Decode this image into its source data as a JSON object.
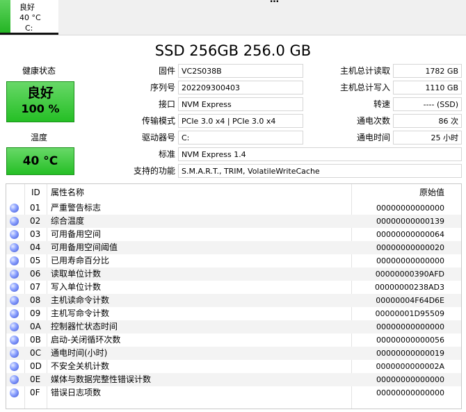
{
  "drive_tab": {
    "status": "良好",
    "temperature": "40 °C",
    "drive_letter": "C:"
  },
  "tab_overflow_glyph": "…",
  "title": "SSD 256GB 256.0 GB",
  "health": {
    "label": "健康状态",
    "status": "良好",
    "percent": "100 %"
  },
  "temperature": {
    "label": "温度",
    "value": "40 °C"
  },
  "info_left": [
    {
      "label": "固件",
      "value": "VC2S038B"
    },
    {
      "label": "序列号",
      "value": "202209300403"
    },
    {
      "label": "接口",
      "value": "NVM Express"
    },
    {
      "label": "传输模式",
      "value": "PCIe 3.0 x4 | PCIe 3.0 x4"
    },
    {
      "label": "驱动器号",
      "value": "C:"
    }
  ],
  "info_right": [
    {
      "label": "主机总计读取",
      "value": "1782 GB"
    },
    {
      "label": "主机总计写入",
      "value": "1110 GB"
    },
    {
      "label": "转速",
      "value": "---- (SSD)"
    },
    {
      "label": "通电次数",
      "value": "86 次"
    },
    {
      "label": "通电时间",
      "value": "25 小时"
    }
  ],
  "standard": {
    "label": "标准",
    "value": "NVM Express 1.4"
  },
  "features": {
    "label": "支持的功能",
    "value": "S.M.A.R.T., TRIM, VolatileWriteCache"
  },
  "table": {
    "headers": {
      "id": "ID",
      "name": "属性名称",
      "raw": "原始值"
    },
    "rows": [
      {
        "id": "01",
        "name": "严重警告标志",
        "raw": "00000000000000"
      },
      {
        "id": "02",
        "name": "综合温度",
        "raw": "00000000000139"
      },
      {
        "id": "03",
        "name": "可用备用空间",
        "raw": "00000000000064"
      },
      {
        "id": "04",
        "name": "可用备用空间阈值",
        "raw": "00000000000020"
      },
      {
        "id": "05",
        "name": "已用寿命百分比",
        "raw": "00000000000000"
      },
      {
        "id": "06",
        "name": "读取单位计数",
        "raw": "00000000390AFD"
      },
      {
        "id": "07",
        "name": "写入单位计数",
        "raw": "00000000238AD3"
      },
      {
        "id": "08",
        "name": "主机读命令计数",
        "raw": "00000004F64D6E"
      },
      {
        "id": "09",
        "name": "主机写命令计数",
        "raw": "00000001D95509"
      },
      {
        "id": "0A",
        "name": "控制器忙状态时间",
        "raw": "00000000000000"
      },
      {
        "id": "0B",
        "name": "启动-关闭循环次数",
        "raw": "00000000000056"
      },
      {
        "id": "0C",
        "name": "通电时间(小时)",
        "raw": "00000000000019"
      },
      {
        "id": "0D",
        "name": "不安全关机计数",
        "raw": "0000000000002A"
      },
      {
        "id": "0E",
        "name": "媒体与数据完整性错误计数",
        "raw": "00000000000000"
      },
      {
        "id": "0F",
        "name": "错误日志项数",
        "raw": "00000000000000"
      }
    ]
  },
  "colors": {
    "good_green": "#25bf25",
    "status_dot_blue": "#3a52d6"
  }
}
